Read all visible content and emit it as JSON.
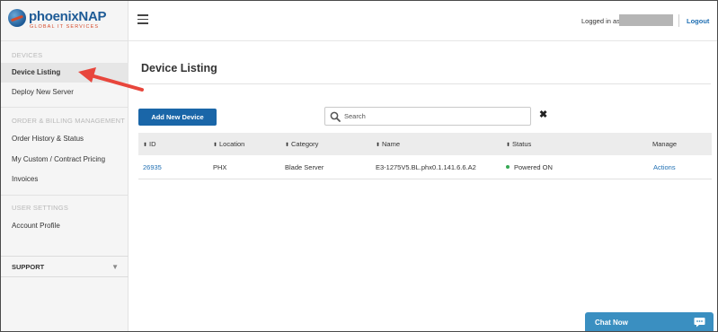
{
  "brand": {
    "name_main": "phoenix",
    "name_accent": "NAP",
    "tagline": "GLOBAL IT SERVICES"
  },
  "sidebar": {
    "sections": [
      {
        "heading": "DEVICES",
        "items": [
          "Device Listing",
          "Deploy New Server"
        ]
      },
      {
        "heading": "ORDER & BILLING MANAGEMENT",
        "items": [
          "Order History & Status",
          "My Custom / Contract Pricing",
          "Invoices"
        ]
      },
      {
        "heading": "USER SETTINGS",
        "items": [
          "Account Profile"
        ]
      }
    ],
    "active_item": "Device Listing",
    "support": {
      "label": "SUPPORT",
      "caret": "▼"
    }
  },
  "header": {
    "logged_in_label": "Logged in as",
    "logout_label": "Logout"
  },
  "main": {
    "title": "Device Listing",
    "add_button": "Add New Device",
    "search": {
      "placeholder": "Search",
      "value": ""
    },
    "clear_symbol": "✖",
    "table": {
      "columns": [
        "ID",
        "Location",
        "Category",
        "Name",
        "Status",
        "Manage"
      ],
      "rows": [
        {
          "id": "26935",
          "location": "PHX",
          "category": "Blade Server",
          "name": "E3-1275V5.BL.phx0.1.141.6.6.A2",
          "status": "Powered ON",
          "manage": "Actions"
        }
      ]
    }
  },
  "chat": {
    "label": "Chat Now"
  },
  "colors": {
    "accent_blue": "#1a66a8",
    "link_blue": "#1f6fb3",
    "status_green": "#35a853",
    "annotation_red": "#e8463c",
    "chat_blue": "#3a8fc1"
  },
  "icons": {
    "menu": "hamburger-icon",
    "search": "search-icon",
    "sort": "sort-icon",
    "support_caret": "caret-down-icon",
    "chat": "chat-bubble-icon",
    "annotation": "red-arrow"
  }
}
